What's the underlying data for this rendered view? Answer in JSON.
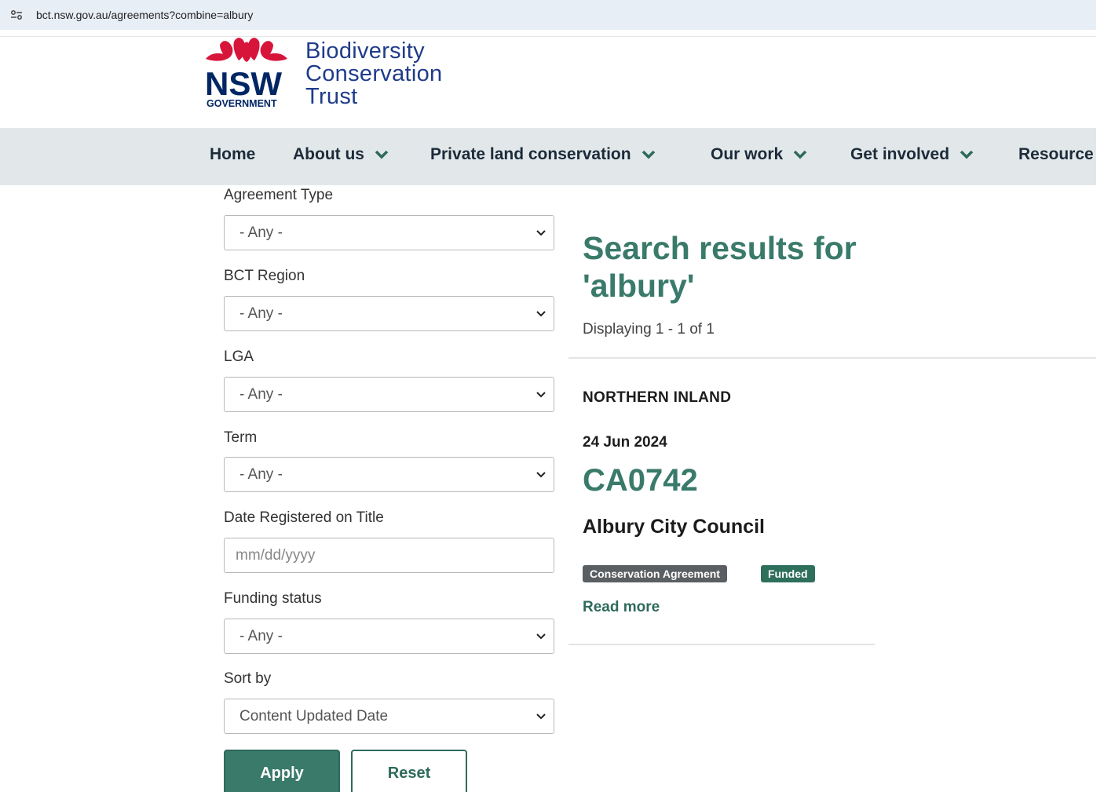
{
  "browser": {
    "url": "bct.nsw.gov.au/agreements?combine=albury",
    "site_info_icon": "tune-icon"
  },
  "header": {
    "logo_nsw": "NSW",
    "logo_government": "GOVERNMENT",
    "logo_line1": "Biodiversity",
    "logo_line2": "Conservation",
    "logo_line3": "Trust",
    "logo_colors": {
      "waratah": "#d7153a",
      "nsw_text": "#002664"
    }
  },
  "nav": {
    "items": [
      {
        "label": "Home",
        "has_dropdown": false
      },
      {
        "label": "About us",
        "has_dropdown": true
      },
      {
        "label": "Private land conservation",
        "has_dropdown": true
      },
      {
        "label": "Our work",
        "has_dropdown": true
      },
      {
        "label": "Get involved",
        "has_dropdown": true
      },
      {
        "label": "Resource",
        "has_dropdown": false
      }
    ]
  },
  "filters": {
    "agreement_type": {
      "label": "Agreement Type",
      "value": "- Any -"
    },
    "bct_region": {
      "label": "BCT Region",
      "value": "- Any -"
    },
    "lga": {
      "label": "LGA",
      "value": "- Any -"
    },
    "term": {
      "label": "Term",
      "value": "- Any -"
    },
    "date_registered": {
      "label": "Date Registered on Title",
      "placeholder": "mm/dd/yyyy"
    },
    "funding_status": {
      "label": "Funding status",
      "value": "- Any -"
    },
    "sort_by": {
      "label": "Sort by",
      "value": "Content Updated Date"
    },
    "apply_label": "Apply",
    "reset_label": "Reset"
  },
  "results": {
    "title": "Search results for 'albury'",
    "count_text": "Displaying 1 - 1 of 1",
    "items": [
      {
        "region": "NORTHERN INLAND",
        "date": "24 Jun 2024",
        "code": "CA0742",
        "council": "Albury City Council",
        "type_badge": "Conservation Agreement",
        "funding_badge": "Funded",
        "read_more": "Read more"
      }
    ]
  },
  "colors": {
    "accent_green": "#3a7a6a",
    "nav_bg": "#e2e8ea",
    "badge_grey": "#5a5f63",
    "badge_green": "#2e6f5c"
  }
}
